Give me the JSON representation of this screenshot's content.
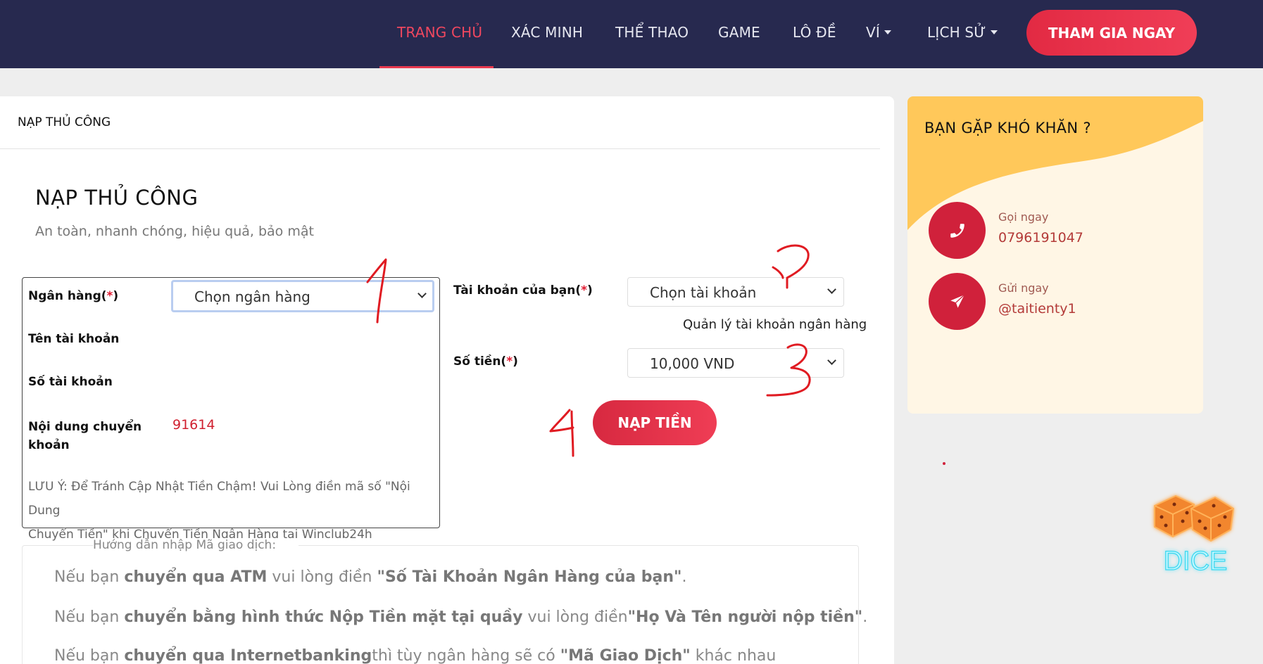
{
  "nav": {
    "items": [
      {
        "label": "TRANG CHỦ",
        "active": true
      },
      {
        "label": "XÁC MINH"
      },
      {
        "label": "THỂ THAO"
      },
      {
        "label": "GAME"
      },
      {
        "label": "LÔ ĐỀ"
      },
      {
        "label": "VÍ",
        "dropdown": true
      },
      {
        "label": "LỊCH SỬ",
        "dropdown": true
      }
    ],
    "cta": "THAM GIA NGAY"
  },
  "main": {
    "header": "NẠP THỦ CÔNG",
    "title": "NẠP THỦ CÔNG",
    "subtitle": "An toàn, nhanh chóng, hiệu quả, bảo mật",
    "bank_box": {
      "bank_label": "Ngân hàng(",
      "required_mark": "*",
      "close_paren": ")",
      "bank_placeholder": "Chọn ngân hàng",
      "account_name_label": "Tên tài khoản",
      "account_number_label": "Số tài khoản",
      "transfer_content_label_1": "Nội dung chuyển",
      "transfer_content_label_2": "khoản",
      "transfer_content_value": "91614",
      "note_1": "LƯU Ý: Để Tránh Cập Nhật Tiền Chậm! Vui Lòng điền mã số \"Nội Dung",
      "note_2": "Chuyển Tiền\" khi Chuyển Tiền Ngân Hàng tại Winclub24h"
    },
    "form": {
      "account_label": "Tài khoản của bạn(",
      "account_placeholder": "Chọn tài khoản",
      "manage_link": "Quản lý tài khoản ngân hàng",
      "amount_label": "Số tiền(",
      "amount_value": "10,000 VND",
      "submit": "NẠP TIỀN"
    },
    "guide": {
      "legend": "Hướng dẫn nhập Mã giao dịch:",
      "l1_a": "Nếu bạn ",
      "l1_b": "chuyển qua ATM",
      "l1_c": " vui lòng điền ",
      "l1_d": "\"Số Tài Khoản Ngân Hàng của bạn\"",
      "l1_e": ".",
      "l2_a": "Nếu bạn ",
      "l2_b": "chuyển bằng hình thức Nộp Tiền mặt tại quầy",
      "l2_c": " vui lòng điền",
      "l2_d": "\"Họ Và Tên người nộp tiền\"",
      "l2_e": ".",
      "l3_a": "Nếu bạn ",
      "l3_b": "chuyển qua Internetbanking",
      "l3_c": "thì tùy ngân hàng sẽ có ",
      "l3_d": "\"Mã Giao Dịch\"",
      "l3_e": " khác nhau"
    }
  },
  "annotations": {
    "n1": "1",
    "n2": "2",
    "n3": "3",
    "n4": "4"
  },
  "side": {
    "title": "BẠN GẶP KHÓ KHĂN ?",
    "call_label": "Gọi ngay",
    "call_value": "0796191047",
    "send_label": "Gửi ngay",
    "send_value": "@taitienty1"
  },
  "logo_text": "DICE",
  "colors": {
    "nav_bg": "#27294f",
    "accent": "#e22a43",
    "side_bg": "#fff6e5",
    "side_wave": "#ffc85a"
  }
}
